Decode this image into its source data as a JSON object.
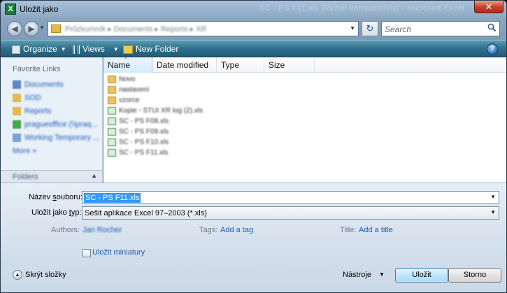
{
  "window": {
    "title": "Uložit jako",
    "background_title": "SC - PS F11.xls [Režim kompatibility] - Microsoft Excel",
    "app_icon_glyph": "X",
    "close_glyph": "✕"
  },
  "nav": {
    "back_glyph": "◀",
    "forward_glyph": "▶",
    "dropdown_glyph": "▼",
    "address_text": "Průzkumník ▸ Documents ▸ Reports ▸ XR",
    "refresh_glyph": "↻",
    "search_placeholder": "Search",
    "search_icon": "search-icon"
  },
  "toolbar": {
    "organize_label": "Organize",
    "views_label": "Views",
    "new_folder_label": "New Folder",
    "help_glyph": "?"
  },
  "sidebar": {
    "heading": "Favorite Links",
    "items": [
      {
        "label": "Documents",
        "icon": "documents-icon",
        "color": "#5f86c8"
      },
      {
        "label": "SOD",
        "icon": "folder-icon",
        "color": "#e2b94b"
      },
      {
        "label": "Reports",
        "icon": "folder-icon",
        "color": "#e2b94b"
      },
      {
        "label": "pragueoffice (\\\\praq...",
        "icon": "network-folder-icon",
        "color": "#4aa64b"
      },
      {
        "label": "Working Temporary ...",
        "icon": "folder-icon",
        "color": "#7fa1d4"
      },
      {
        "label": "More »",
        "icon": "",
        "color": ""
      }
    ],
    "folders_label": "Folders",
    "folders_chevron": "▲"
  },
  "files": {
    "columns": {
      "name": "Name",
      "date": "Date modified",
      "type": "Type",
      "size": "Size"
    },
    "sort_glyph": "^",
    "rows": [
      {
        "name": "Novo",
        "kind": "folder"
      },
      {
        "name": "nastavení",
        "kind": "folder"
      },
      {
        "name": "vzorce",
        "kind": "folder"
      },
      {
        "name": "Kopie - STUI XR log (2).xls",
        "kind": "xls"
      },
      {
        "name": "SC - PS F08.xls",
        "kind": "xls"
      },
      {
        "name": "SC - PS F09.xls",
        "kind": "xls"
      },
      {
        "name": "SC - PS F10.xls",
        "kind": "xls"
      },
      {
        "name": "SC - PS F11.xls",
        "kind": "xls"
      }
    ]
  },
  "form": {
    "filename_label_pre": "Název ",
    "filename_label_u": "s",
    "filename_label_post": "ouboru:",
    "filename_value": "SC - PS F11.xls",
    "type_label_pre": "Uložit jako ",
    "type_label_u": "t",
    "type_label_post": "yp:",
    "type_value": "Sešit aplikace Excel 97–2003 (*.xls)",
    "authors_label": "Authors:",
    "authors_value": "Jan Rocher",
    "tags_label": "Tags:",
    "tags_value": "Add a tag",
    "title_label": "Title:",
    "title_value": "Add a title",
    "thumbnail_label": "Uložit miniatury",
    "hide_folders_label": "Skrýt složky",
    "hide_glyph": "▲",
    "tools_label": "Nástroje",
    "tools_dd": "▼",
    "save_label": "Uložit",
    "cancel_label": "Storno"
  },
  "colors": {
    "accent": "#215c78",
    "link": "#1f5dbb",
    "selection": "#3399ff"
  }
}
